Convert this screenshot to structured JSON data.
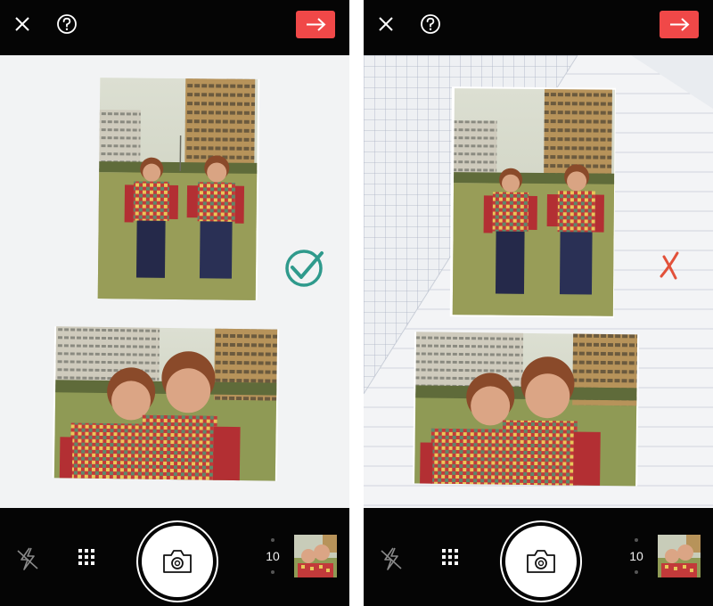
{
  "screens": [
    {
      "id": "left",
      "scan_count": "10",
      "result": "approved",
      "result_icon": "checkmark-circle-icon",
      "result_color": "#2f9a8c"
    },
    {
      "id": "right",
      "scan_count": "10",
      "result": "rejected",
      "result_icon": "x-mark-icon",
      "result_color": "#e2513a"
    }
  ],
  "icons": {
    "close": "close-icon",
    "help": "help-icon",
    "next": "arrow-right-icon",
    "flash": "flash-off-icon",
    "grid": "grid-icon",
    "shutter": "camera-icon"
  },
  "colors": {
    "accent": "#f04848",
    "bar_background": "#050505",
    "viewfinder_background": "#f2f3f4"
  }
}
